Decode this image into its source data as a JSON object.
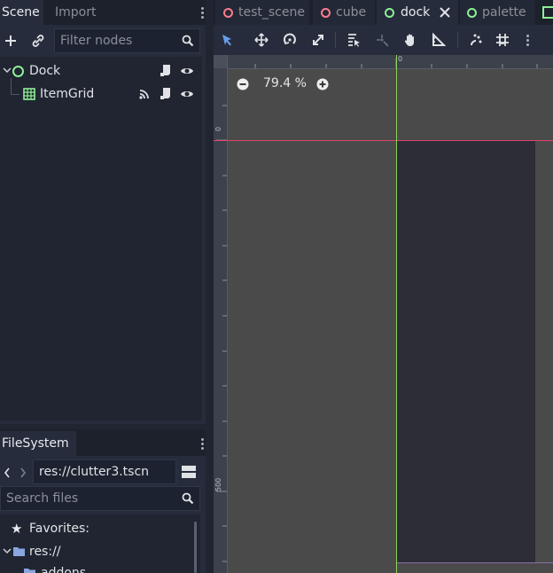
{
  "scene_dock": {
    "tabs": [
      {
        "label": "Scene",
        "active": true
      },
      {
        "label": "Import",
        "active": false
      }
    ],
    "filter_placeholder": "Filter nodes",
    "nodes": [
      {
        "name": "Dock",
        "icon": "control-node-icon"
      },
      {
        "name": "ItemGrid",
        "icon": "grid-container-icon"
      }
    ]
  },
  "filesystem_dock": {
    "tab_label": "FileSystem",
    "path_value": "res://clutter3.tscn",
    "search_placeholder": "Search files",
    "items": [
      {
        "label": "Favorites:",
        "icon": "star-icon"
      },
      {
        "label": "res://",
        "icon": "folder-icon"
      }
    ],
    "partial_item": "addons"
  },
  "editor_tabs": [
    {
      "label": "test_scene",
      "active": false,
      "color": "#ff7b8a"
    },
    {
      "label": "cube",
      "active": false,
      "color": "#ff7b8a"
    },
    {
      "label": "dock",
      "active": true,
      "color": "#8eef97"
    },
    {
      "label": "palette",
      "active": false,
      "color": "#8eef97"
    }
  ],
  "viewport": {
    "zoom_label": "79.4 %",
    "ruler_h_label": "0",
    "ruler_v_label_top": "0",
    "ruler_v_label_bottom": "500"
  },
  "colors": {
    "accent": "#699ce8",
    "x_axis": "#e0446a",
    "y_axis": "#8dd35a",
    "canvas_bg": "#4a4a4a",
    "control_bg": "#2c2d37"
  }
}
